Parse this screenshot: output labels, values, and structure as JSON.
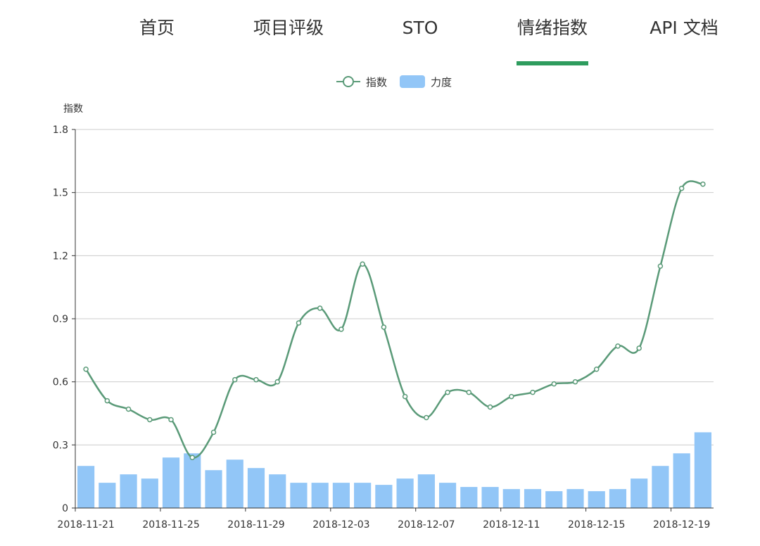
{
  "nav": {
    "items": [
      {
        "label": "首页",
        "active": false
      },
      {
        "label": "项目评级",
        "active": false
      },
      {
        "label": "STO",
        "active": false
      },
      {
        "label": "情绪指数",
        "active": true
      },
      {
        "label": "API 文档",
        "active": false
      }
    ],
    "accent": "#2e9c5e"
  },
  "chart_data": {
    "type": "line",
    "title": "",
    "ylabel": "指数",
    "xlabel": "",
    "ylim": [
      0,
      1.8
    ],
    "yticks": [
      "0",
      "0.3",
      "0.6",
      "0.9",
      "1.2",
      "1.5",
      "1.8"
    ],
    "x": [
      "2018-11-21",
      "2018-11-22",
      "2018-11-23",
      "2018-11-24",
      "2018-11-25",
      "2018-11-26",
      "2018-11-27",
      "2018-11-28",
      "2018-11-29",
      "2018-11-30",
      "2018-12-01",
      "2018-12-02",
      "2018-12-03",
      "2018-12-04",
      "2018-12-05",
      "2018-12-06",
      "2018-12-07",
      "2018-12-08",
      "2018-12-09",
      "2018-12-10",
      "2018-12-11",
      "2018-12-12",
      "2018-12-13",
      "2018-12-14",
      "2018-12-15",
      "2018-12-16",
      "2018-12-17",
      "2018-12-18",
      "2018-12-19",
      "2018-12-20"
    ],
    "xtick_labels": [
      "2018-11-21",
      "2018-11-25",
      "2018-11-29",
      "2018-12-03",
      "2018-12-07",
      "2018-12-11",
      "2018-12-15",
      "2018-12-19"
    ],
    "legend": {
      "position": "top-center"
    },
    "grid": true,
    "series": [
      {
        "name": "指数",
        "type": "line",
        "color": "#5a9a78",
        "values": [
          0.66,
          0.51,
          0.47,
          0.42,
          0.42,
          0.24,
          0.36,
          0.61,
          0.61,
          0.6,
          0.88,
          0.95,
          0.85,
          1.16,
          0.86,
          0.53,
          0.43,
          0.55,
          0.55,
          0.48,
          0.53,
          0.55,
          0.59,
          0.6,
          0.66,
          0.77,
          0.76,
          1.15,
          1.52,
          1.54
        ]
      },
      {
        "name": "力度",
        "type": "bar",
        "color": "#92c6f7",
        "values": [
          0.2,
          0.12,
          0.16,
          0.14,
          0.24,
          0.26,
          0.18,
          0.23,
          0.19,
          0.16,
          0.12,
          0.12,
          0.12,
          0.12,
          0.11,
          0.14,
          0.16,
          0.12,
          0.1,
          0.1,
          0.09,
          0.09,
          0.08,
          0.09,
          0.08,
          0.09,
          0.14,
          0.2,
          0.26,
          0.36
        ]
      }
    ]
  }
}
